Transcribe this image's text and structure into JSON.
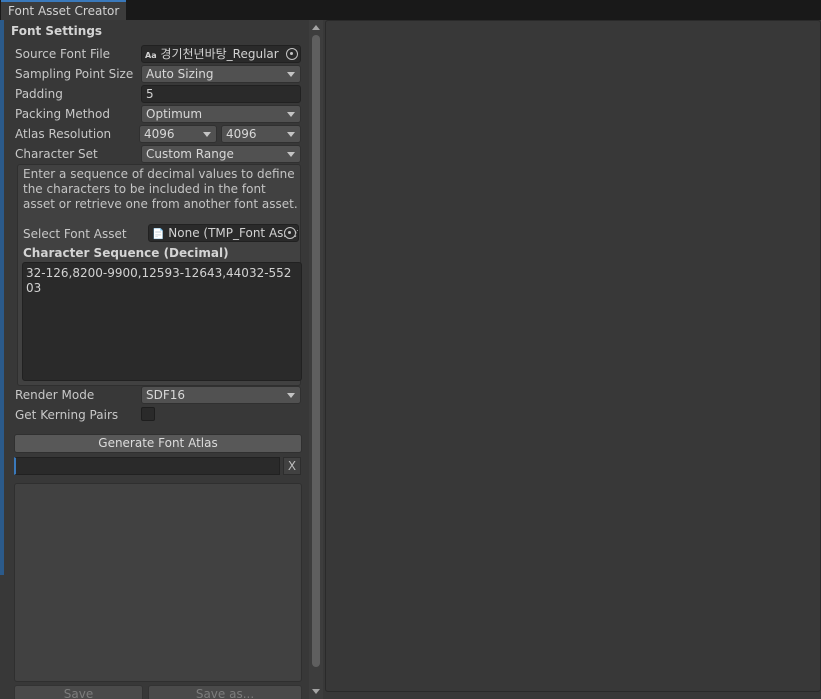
{
  "window": {
    "tab_title": "Font Asset Creator"
  },
  "settings": {
    "section_title": "Font Settings",
    "source_font_file": {
      "label": "Source Font File",
      "icon_text": "Aa",
      "value": "경기천년바탕_Regular"
    },
    "sampling_point_size": {
      "label": "Sampling Point Size",
      "value": "Auto Sizing"
    },
    "padding": {
      "label": "Padding",
      "value": "5"
    },
    "packing_method": {
      "label": "Packing Method",
      "value": "Optimum"
    },
    "atlas_resolution": {
      "label": "Atlas Resolution",
      "width": "4096",
      "height": "4096"
    },
    "character_set": {
      "label": "Character Set",
      "value": "Custom Range"
    },
    "help_text": "Enter a sequence of decimal values to define the characters to be included in the font asset or retrieve one from another font asset.",
    "select_font_asset": {
      "label": "Select Font Asset",
      "value": "None (TMP_Font Asset)"
    },
    "character_sequence": {
      "label": "Character Sequence (Decimal)",
      "value": "32-126,8200-9900,12593-12643,44032-55203"
    },
    "render_mode": {
      "label": "Render Mode",
      "value": "SDF16"
    },
    "get_kerning_pairs": {
      "label": "Get Kerning Pairs",
      "checked": false
    }
  },
  "actions": {
    "generate": "Generate Font Atlas",
    "clear_progress": "X",
    "save": "Save",
    "save_as": "Save as..."
  },
  "colors": {
    "background": "#383838",
    "accent": "#3a79bb"
  }
}
